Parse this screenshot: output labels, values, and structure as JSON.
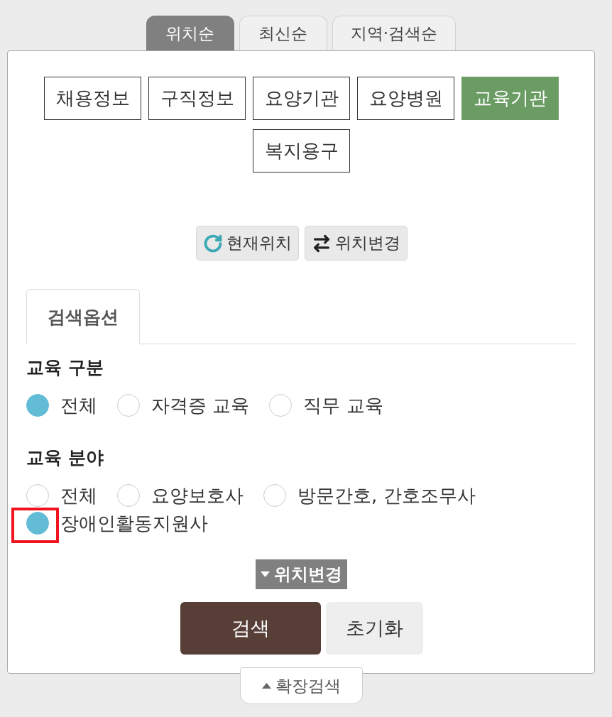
{
  "sort_tabs": [
    {
      "label": "위치순",
      "selected": true
    },
    {
      "label": "최신순",
      "selected": false
    },
    {
      "label": "지역·검색순",
      "selected": false
    }
  ],
  "categories": [
    {
      "label": "채용정보",
      "selected": false
    },
    {
      "label": "구직정보",
      "selected": false
    },
    {
      "label": "요양기관",
      "selected": false
    },
    {
      "label": "요양병원",
      "selected": false
    },
    {
      "label": "교육기관",
      "selected": true
    },
    {
      "label": "복지용구",
      "selected": false
    }
  ],
  "location_buttons": [
    {
      "kind": "current",
      "label": "현재위치"
    },
    {
      "kind": "change",
      "label": "위치변경"
    }
  ],
  "options_tab": {
    "label": "검색옵션"
  },
  "option_groups": [
    {
      "title": "교육 구분",
      "options": [
        {
          "label": "전체",
          "selected": true,
          "highlighted": false
        },
        {
          "label": "자격증 교육",
          "selected": false,
          "highlighted": false
        },
        {
          "label": "직무 교육",
          "selected": false,
          "highlighted": false
        }
      ]
    },
    {
      "title": "교육 분야",
      "options": [
        {
          "label": "전체",
          "selected": false,
          "highlighted": false
        },
        {
          "label": "요양보호사",
          "selected": false,
          "highlighted": false
        },
        {
          "label": "방문간호, 간호조무사",
          "selected": false,
          "highlighted": false
        },
        {
          "label": "장애인활동지원사",
          "selected": true,
          "highlighted": true
        }
      ]
    }
  ],
  "location_toggle": {
    "label": "위치변경"
  },
  "actions": [
    {
      "kind": "primary",
      "label": "검색"
    },
    {
      "kind": "secondary",
      "label": "초기화"
    }
  ],
  "expand_tab": {
    "label": "확장검색"
  }
}
